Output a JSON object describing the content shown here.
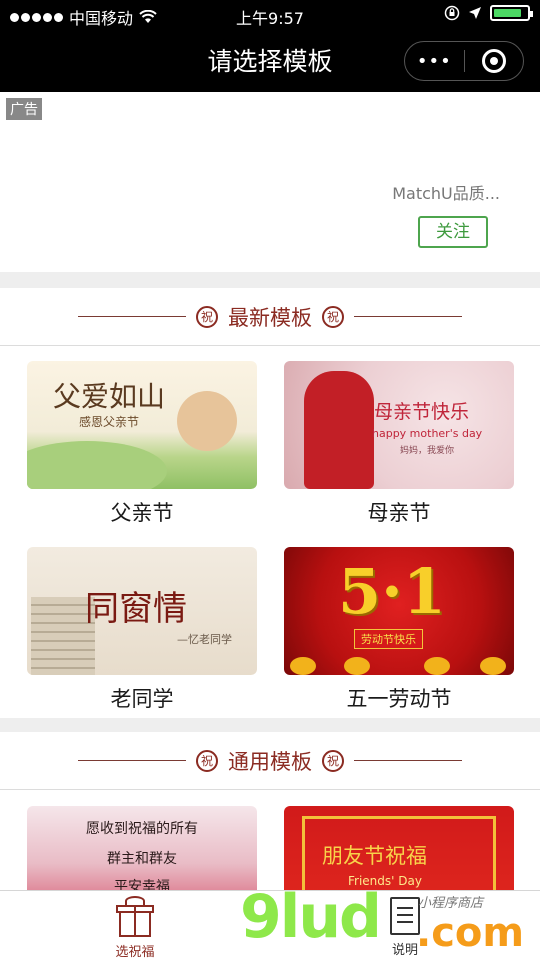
{
  "status_bar": {
    "carrier": "中国移动",
    "time": "上午9:57",
    "battery_level": 0.85
  },
  "nav": {
    "title": "请选择模板",
    "more_label": "•••"
  },
  "ad": {
    "tag": "广告",
    "brand": "MatchU品质...",
    "follow_label": "关注"
  },
  "sections": [
    {
      "title": "最新模板",
      "badge": "祝",
      "cards": [
        {
          "label": "父亲节",
          "image_text": [
            "父爱如山",
            "感恩父亲节"
          ]
        },
        {
          "label": "母亲节",
          "image_text": [
            "母亲节快乐",
            "happy mother's day",
            "妈妈，我爱你"
          ]
        },
        {
          "label": "老同学",
          "image_text": [
            "同窗情",
            "—忆老同学"
          ]
        },
        {
          "label": "五一劳动节",
          "image_text": [
            "5·1",
            "劳动节快乐"
          ]
        }
      ]
    },
    {
      "title": "通用模板",
      "badge": "祝",
      "cards": [
        {
          "label": "",
          "image_text": [
            "愿收到祝福的所有",
            "群主和群友",
            "平安幸福"
          ]
        },
        {
          "label": "",
          "image_text": [
            "朋友节祝福",
            "Friends' Day"
          ]
        }
      ]
    }
  ],
  "tabbar": {
    "tabs": [
      {
        "label": "选祝福",
        "icon": "gift-icon",
        "active": true
      },
      {
        "label": "说明",
        "icon": "document-icon",
        "active": false
      }
    ]
  },
  "watermark": {
    "logo": "9lud",
    "suffix": ".com",
    "subtitle": "小程序商店"
  },
  "colors": {
    "accent": "#8b2b22",
    "follow_green": "#3e9a3e",
    "nav_bg": "#000000"
  }
}
